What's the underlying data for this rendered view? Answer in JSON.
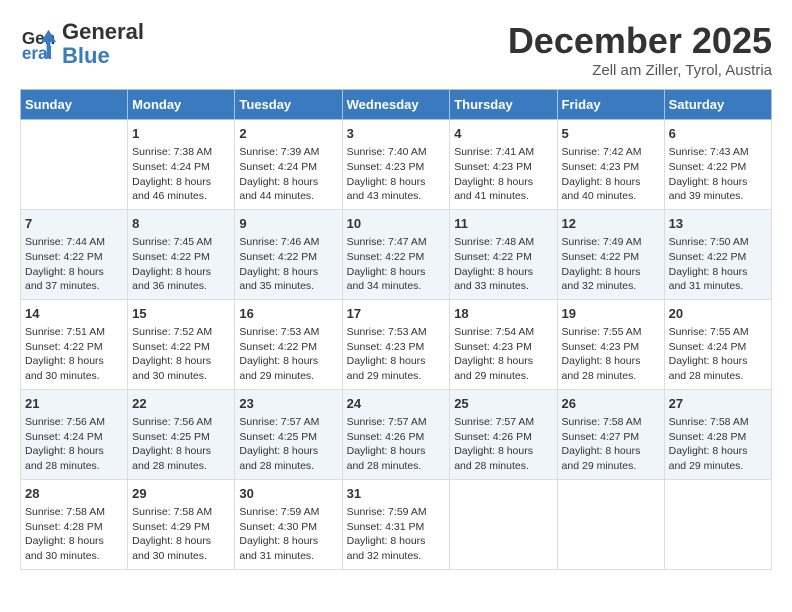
{
  "header": {
    "logo_line1": "General",
    "logo_line2": "Blue",
    "month": "December 2025",
    "location": "Zell am Ziller, Tyrol, Austria"
  },
  "weekdays": [
    "Sunday",
    "Monday",
    "Tuesday",
    "Wednesday",
    "Thursday",
    "Friday",
    "Saturday"
  ],
  "weeks": [
    [
      {
        "day": "",
        "info": ""
      },
      {
        "day": "1",
        "info": "Sunrise: 7:38 AM\nSunset: 4:24 PM\nDaylight: 8 hours\nand 46 minutes."
      },
      {
        "day": "2",
        "info": "Sunrise: 7:39 AM\nSunset: 4:24 PM\nDaylight: 8 hours\nand 44 minutes."
      },
      {
        "day": "3",
        "info": "Sunrise: 7:40 AM\nSunset: 4:23 PM\nDaylight: 8 hours\nand 43 minutes."
      },
      {
        "day": "4",
        "info": "Sunrise: 7:41 AM\nSunset: 4:23 PM\nDaylight: 8 hours\nand 41 minutes."
      },
      {
        "day": "5",
        "info": "Sunrise: 7:42 AM\nSunset: 4:23 PM\nDaylight: 8 hours\nand 40 minutes."
      },
      {
        "day": "6",
        "info": "Sunrise: 7:43 AM\nSunset: 4:22 PM\nDaylight: 8 hours\nand 39 minutes."
      }
    ],
    [
      {
        "day": "7",
        "info": "Sunrise: 7:44 AM\nSunset: 4:22 PM\nDaylight: 8 hours\nand 37 minutes."
      },
      {
        "day": "8",
        "info": "Sunrise: 7:45 AM\nSunset: 4:22 PM\nDaylight: 8 hours\nand 36 minutes."
      },
      {
        "day": "9",
        "info": "Sunrise: 7:46 AM\nSunset: 4:22 PM\nDaylight: 8 hours\nand 35 minutes."
      },
      {
        "day": "10",
        "info": "Sunrise: 7:47 AM\nSunset: 4:22 PM\nDaylight: 8 hours\nand 34 minutes."
      },
      {
        "day": "11",
        "info": "Sunrise: 7:48 AM\nSunset: 4:22 PM\nDaylight: 8 hours\nand 33 minutes."
      },
      {
        "day": "12",
        "info": "Sunrise: 7:49 AM\nSunset: 4:22 PM\nDaylight: 8 hours\nand 32 minutes."
      },
      {
        "day": "13",
        "info": "Sunrise: 7:50 AM\nSunset: 4:22 PM\nDaylight: 8 hours\nand 31 minutes."
      }
    ],
    [
      {
        "day": "14",
        "info": "Sunrise: 7:51 AM\nSunset: 4:22 PM\nDaylight: 8 hours\nand 30 minutes."
      },
      {
        "day": "15",
        "info": "Sunrise: 7:52 AM\nSunset: 4:22 PM\nDaylight: 8 hours\nand 30 minutes."
      },
      {
        "day": "16",
        "info": "Sunrise: 7:53 AM\nSunset: 4:22 PM\nDaylight: 8 hours\nand 29 minutes."
      },
      {
        "day": "17",
        "info": "Sunrise: 7:53 AM\nSunset: 4:23 PM\nDaylight: 8 hours\nand 29 minutes."
      },
      {
        "day": "18",
        "info": "Sunrise: 7:54 AM\nSunset: 4:23 PM\nDaylight: 8 hours\nand 29 minutes."
      },
      {
        "day": "19",
        "info": "Sunrise: 7:55 AM\nSunset: 4:23 PM\nDaylight: 8 hours\nand 28 minutes."
      },
      {
        "day": "20",
        "info": "Sunrise: 7:55 AM\nSunset: 4:24 PM\nDaylight: 8 hours\nand 28 minutes."
      }
    ],
    [
      {
        "day": "21",
        "info": "Sunrise: 7:56 AM\nSunset: 4:24 PM\nDaylight: 8 hours\nand 28 minutes."
      },
      {
        "day": "22",
        "info": "Sunrise: 7:56 AM\nSunset: 4:25 PM\nDaylight: 8 hours\nand 28 minutes."
      },
      {
        "day": "23",
        "info": "Sunrise: 7:57 AM\nSunset: 4:25 PM\nDaylight: 8 hours\nand 28 minutes."
      },
      {
        "day": "24",
        "info": "Sunrise: 7:57 AM\nSunset: 4:26 PM\nDaylight: 8 hours\nand 28 minutes."
      },
      {
        "day": "25",
        "info": "Sunrise: 7:57 AM\nSunset: 4:26 PM\nDaylight: 8 hours\nand 28 minutes."
      },
      {
        "day": "26",
        "info": "Sunrise: 7:58 AM\nSunset: 4:27 PM\nDaylight: 8 hours\nand 29 minutes."
      },
      {
        "day": "27",
        "info": "Sunrise: 7:58 AM\nSunset: 4:28 PM\nDaylight: 8 hours\nand 29 minutes."
      }
    ],
    [
      {
        "day": "28",
        "info": "Sunrise: 7:58 AM\nSunset: 4:28 PM\nDaylight: 8 hours\nand 30 minutes."
      },
      {
        "day": "29",
        "info": "Sunrise: 7:58 AM\nSunset: 4:29 PM\nDaylight: 8 hours\nand 30 minutes."
      },
      {
        "day": "30",
        "info": "Sunrise: 7:59 AM\nSunset: 4:30 PM\nDaylight: 8 hours\nand 31 minutes."
      },
      {
        "day": "31",
        "info": "Sunrise: 7:59 AM\nSunset: 4:31 PM\nDaylight: 8 hours\nand 32 minutes."
      },
      {
        "day": "",
        "info": ""
      },
      {
        "day": "",
        "info": ""
      },
      {
        "day": "",
        "info": ""
      }
    ]
  ]
}
